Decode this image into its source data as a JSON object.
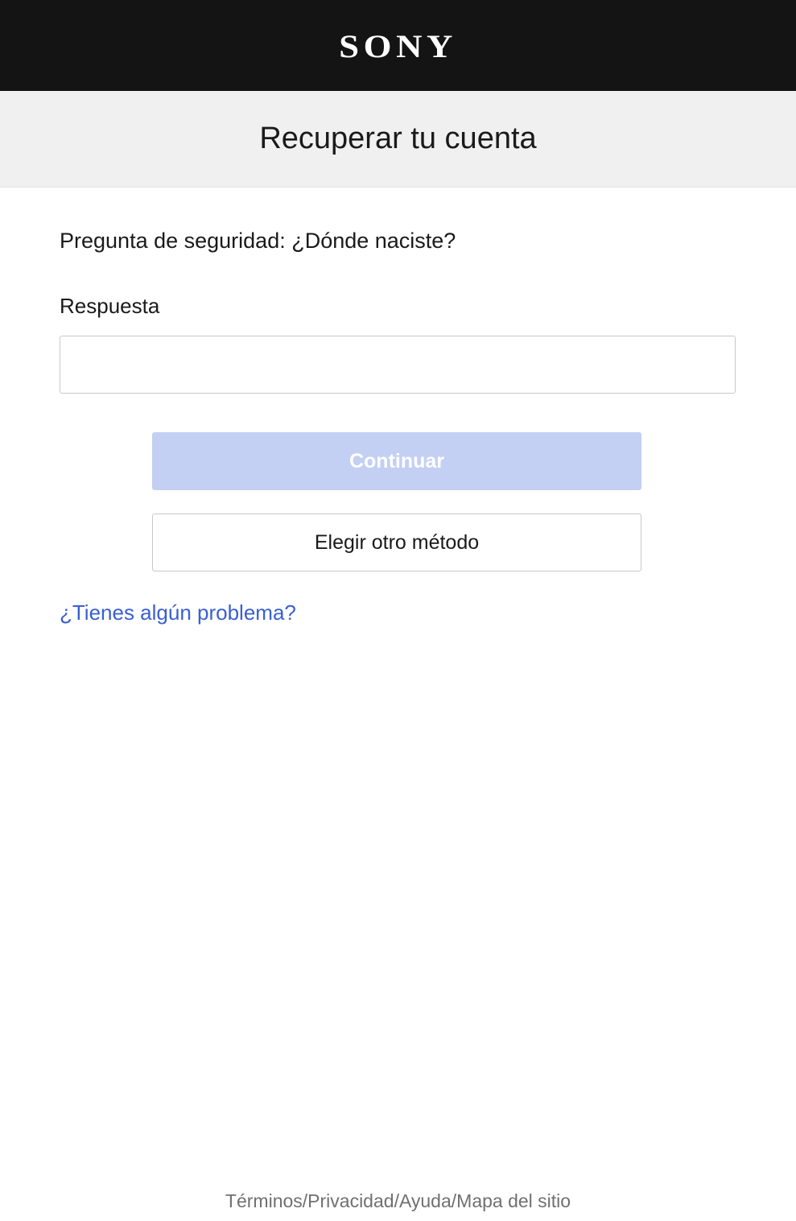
{
  "header": {
    "logo_text": "SONY",
    "background_color": "#141414"
  },
  "title_band": {
    "title": "Recuperar tu cuenta",
    "background_color": "#f0f0f0"
  },
  "form": {
    "security_question": "Pregunta de seguridad: ¿Dónde naciste?",
    "answer_label": "Respuesta",
    "answer_value": "",
    "continue_label": "Continuar",
    "continue_state": "disabled",
    "continue_color": "#c3d0f3",
    "other_method_label": "Elegir otro método",
    "help_link": "¿Tienes algún problema?",
    "link_color": "#3a5fd0"
  },
  "footer": {
    "links": [
      {
        "label": "Términos"
      },
      {
        "label": "Privacidad"
      },
      {
        "label": "Ayuda"
      },
      {
        "label": "Mapa del sitio"
      }
    ],
    "separator": "/"
  }
}
